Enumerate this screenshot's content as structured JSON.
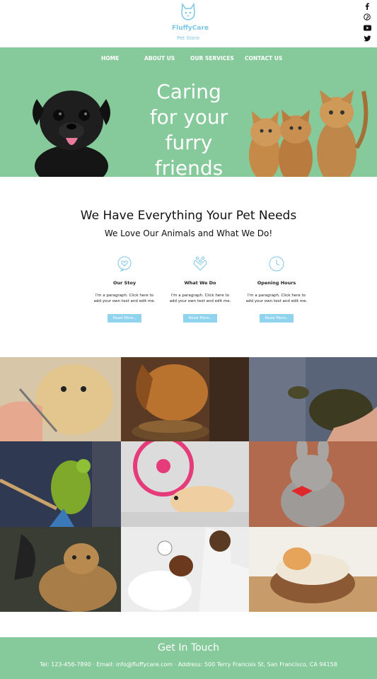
{
  "brand": {
    "name": "FluffyCare",
    "tagline": "Pet Store"
  },
  "social": [
    "facebook-icon",
    "pinterest-icon",
    "youtube-icon",
    "twitter-icon"
  ],
  "nav": [
    "HOME",
    "ABOUT US",
    "OUR SERVICES",
    "CONTACT US"
  ],
  "hero": {
    "line1": "Caring",
    "line2": "for your",
    "line3": "furry friends"
  },
  "intro": {
    "title": "We Have Everything Your Pet Needs",
    "subtitle": "We Love Our Animals and What We Do!"
  },
  "features": [
    {
      "title": "Our Stoy",
      "text": "I'm a paragraph. Click here to add your own text and edit me.",
      "button": "Read More.."
    },
    {
      "title": "What We Do",
      "text": "I'm a paragraph. Click here to add your own text and edit me.",
      "button": "Read More.."
    },
    {
      "title": "Opening Hours",
      "text": "I'm a paragraph. Click here to add your own text and edit me.",
      "button": "Read More.."
    }
  ],
  "footer": {
    "title": "Get In Touch",
    "contact": "Tel: 123-456-7890 · Email: info@fluffycare.com · Address: 500 Terry Francois St, San Francisco, CA 94158"
  },
  "colors": {
    "green": "#86c99a",
    "blue": "#7cc7e6"
  }
}
